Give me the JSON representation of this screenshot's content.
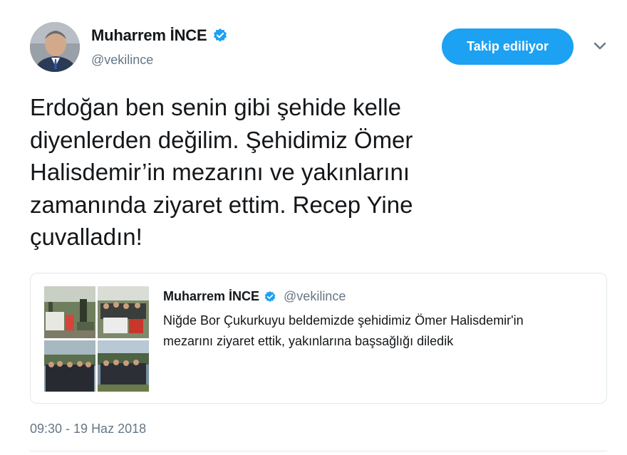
{
  "author": {
    "name": "Muharrem İNCE",
    "handle": "@vekilince"
  },
  "follow_button": {
    "label": "Takip ediliyor"
  },
  "icons": {
    "verified": "verified-badge-icon",
    "more": "chevron-down-icon"
  },
  "colors": {
    "accent": "#1da1f2",
    "secondary_text": "#657786",
    "border": "#e1e8ed"
  },
  "tweet": {
    "lines": [
      "Erdoğan ben senin gibi şehide kelle",
      "diyenlerden değilim. Şehidimiz Ömer",
      "Halisdemir’in mezarını ve yakınlarını",
      "zamanında ziyaret ettim. Recep Yine",
      "çuvalladın!"
    ],
    "timestamp": "09:30 - 19 Haz 2018"
  },
  "quoted_tweet": {
    "name": "Muharrem İNCE",
    "handle": "@vekilince",
    "lines": [
      "Niğde Bor Çukurkuyu beldemizde şehidimiz Ömer Halisdemir'in",
      "mezarını ziyaret ettik, yakınlarına başsağlığı diledik"
    ]
  }
}
